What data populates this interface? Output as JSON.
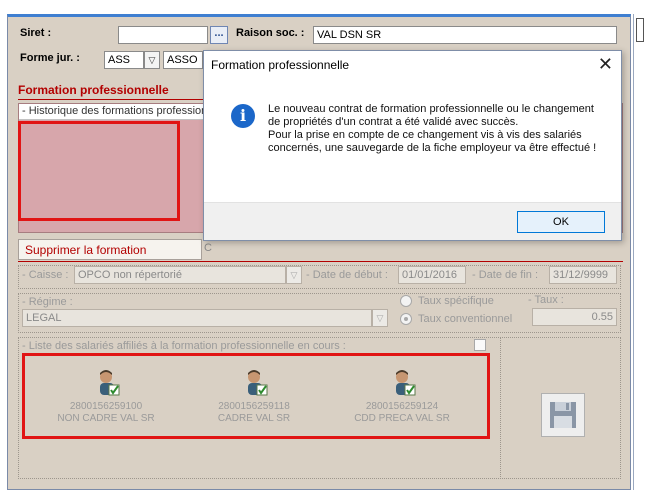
{
  "employer": {
    "siret_label": "Siret :",
    "siret_value": "",
    "dots_label": "...",
    "raison_label": "Raison soc. :",
    "raison_value": "VAL DSN SR",
    "forme_label": "Forme jur. :",
    "forme_code": "ASS",
    "forme_text": "ASSO"
  },
  "section": {
    "title": "Formation professionnelle",
    "history_label": "- Historique des formations profession",
    "delete_button": "Supprimer la formation",
    "delete_sep": "C"
  },
  "details": {
    "caisse_label": "- Caisse :",
    "caisse_value": "OPCO non répertorié",
    "date_debut_label": "- Date de début :",
    "date_debut_value": "01/01/2016",
    "date_fin_label": "- Date de fin :",
    "date_fin_value": "31/12/9999",
    "regime_label": "- Régime :",
    "regime_value": "LEGAL",
    "taux_specifique": "Taux spécifique",
    "taux_conventionnel": "Taux conventionnel",
    "taux_label": "- Taux :",
    "taux_value": "0.55",
    "taux_mode_selected": "Taux conventionnel"
  },
  "salaries": {
    "label": "- Liste des salariés affiliés à la formation professionnelle en cours :",
    "items": [
      {
        "id": "2800156259100",
        "name": "NON CADRE VAL SR"
      },
      {
        "id": "2800156259118",
        "name": "CADRE VAL SR"
      },
      {
        "id": "2800156259124",
        "name": "CDD PRECA VAL SR"
      }
    ]
  },
  "dialog": {
    "title": "Formation professionnelle",
    "close": "✕",
    "message_1": "Le nouveau contrat de formation professionnelle ou le changement de propriétés d'un contrat a été validé avec succès.",
    "message_2": "Pour la prise en compte de ce changement vis à vis des salariés concernés, une sauvegarde de la fiche employeur va être effectué !",
    "ok": "OK"
  },
  "icons": {
    "info": "info-icon",
    "save": "floppy-disk-icon",
    "employee": "user-checked-icon",
    "dropdown": "chevron-down-icon"
  },
  "colors": {
    "accent_red": "#b30000",
    "highlight_red": "#e11414",
    "window_bg": "#d9d0c4",
    "info_blue": "#1b67c9"
  }
}
